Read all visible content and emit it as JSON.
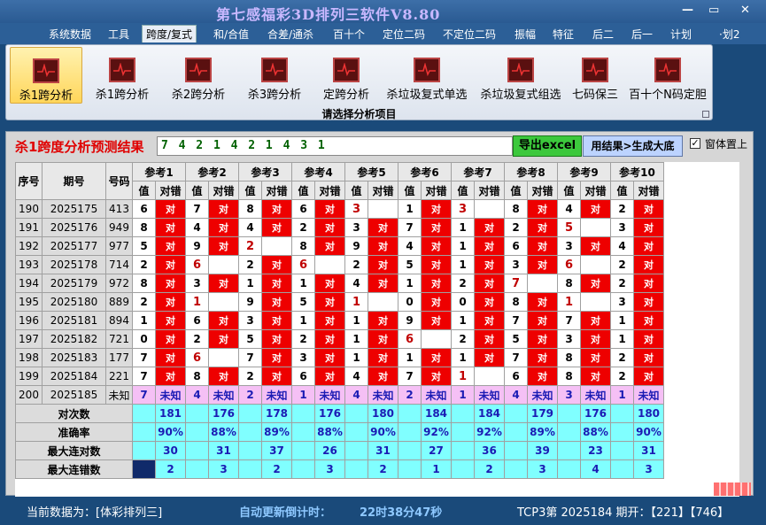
{
  "window": {
    "title": "第七感福彩3D排列三软件V8.80",
    "minimize": "—",
    "restore": "▭",
    "close": "✕"
  },
  "menu": [
    {
      "label": "系统数据"
    },
    {
      "label": "工具"
    },
    {
      "label": "跨度/复式",
      "active": true
    },
    {
      "label": "和/合值"
    },
    {
      "label": "合差/通杀"
    },
    {
      "label": "百十个"
    },
    {
      "label": "定位二码"
    },
    {
      "label": "不定位二码"
    },
    {
      "label": "振幅"
    },
    {
      "label": "特征"
    },
    {
      "label": "后二"
    },
    {
      "label": "后一"
    },
    {
      "label": "计划"
    },
    {
      "label": "·划2"
    }
  ],
  "ribbon": {
    "buttons": [
      "杀1跨分析",
      "杀1跨分析",
      "杀2跨分析",
      "杀3跨分析",
      "定跨分析",
      "杀垃圾复式单选",
      "杀垃圾复式组选",
      "七码保三",
      "百十个N码定胆"
    ],
    "active_index": 0,
    "icon": "chart-icon",
    "group_label": "请选择分析项目"
  },
  "analysis": {
    "title": "杀1跨度分析预测结果",
    "result": "7 4 2 1 4 2 1 4 3 1",
    "excel_button": "导出excel",
    "generate_button": "用结果>生成大底",
    "topmost_label": "窗体置上",
    "topmost_checked": "✓"
  },
  "table": {
    "col_seq": "序号",
    "col_period": "期号",
    "col_number": "号码",
    "refs": [
      "参考1",
      "参考2",
      "参考3",
      "参考4",
      "参考5",
      "参考6",
      "参考7",
      "参考8",
      "参考9",
      "参考10"
    ],
    "sub_val": "值",
    "sub_check": "对错",
    "check_mark": "对",
    "rows": [
      {
        "seq": "190",
        "period": "2025175",
        "num": "413",
        "cells": [
          [
            "6",
            "R"
          ],
          [
            "7",
            "R"
          ],
          [
            "8",
            "R"
          ],
          [
            "6",
            "R"
          ],
          [
            "3",
            "X"
          ],
          [
            "1",
            "R"
          ],
          [
            "3",
            "X"
          ],
          [
            "8",
            "R"
          ],
          [
            "4",
            "R"
          ],
          [
            "2",
            "R"
          ]
        ]
      },
      {
        "seq": "191",
        "period": "2025176",
        "num": "949",
        "cells": [
          [
            "8",
            "R"
          ],
          [
            "4",
            "R"
          ],
          [
            "4",
            "R"
          ],
          [
            "2",
            "R"
          ],
          [
            "3",
            "R"
          ],
          [
            "7",
            "R"
          ],
          [
            "1",
            "R"
          ],
          [
            "2",
            "R"
          ],
          [
            "5",
            "X"
          ],
          [
            "3",
            "R"
          ]
        ]
      },
      {
        "seq": "192",
        "period": "2025177",
        "num": "977",
        "cells": [
          [
            "5",
            "R"
          ],
          [
            "9",
            "R"
          ],
          [
            "2",
            "X"
          ],
          [
            "8",
            "R"
          ],
          [
            "9",
            "R"
          ],
          [
            "4",
            "R"
          ],
          [
            "1",
            "R"
          ],
          [
            "6",
            "R"
          ],
          [
            "3",
            "R"
          ],
          [
            "4",
            "R"
          ]
        ]
      },
      {
        "seq": "193",
        "period": "2025178",
        "num": "714",
        "cells": [
          [
            "2",
            "R"
          ],
          [
            "6",
            "X"
          ],
          [
            "2",
            "R"
          ],
          [
            "6",
            "X"
          ],
          [
            "2",
            "R"
          ],
          [
            "5",
            "R"
          ],
          [
            "1",
            "R"
          ],
          [
            "3",
            "R"
          ],
          [
            "6",
            "X"
          ],
          [
            "2",
            "R"
          ]
        ]
      },
      {
        "seq": "194",
        "period": "2025179",
        "num": "972",
        "cells": [
          [
            "8",
            "R"
          ],
          [
            "3",
            "R"
          ],
          [
            "1",
            "R"
          ],
          [
            "1",
            "R"
          ],
          [
            "4",
            "R"
          ],
          [
            "1",
            "R"
          ],
          [
            "2",
            "R"
          ],
          [
            "7",
            "X"
          ],
          [
            "8",
            "R"
          ],
          [
            "2",
            "R"
          ]
        ]
      },
      {
        "seq": "195",
        "period": "2025180",
        "num": "889",
        "cells": [
          [
            "2",
            "R"
          ],
          [
            "1",
            "X"
          ],
          [
            "9",
            "R"
          ],
          [
            "5",
            "R"
          ],
          [
            "1",
            "X"
          ],
          [
            "0",
            "R"
          ],
          [
            "0",
            "R"
          ],
          [
            "8",
            "R"
          ],
          [
            "1",
            "X"
          ],
          [
            "3",
            "R"
          ]
        ]
      },
      {
        "seq": "196",
        "period": "2025181",
        "num": "894",
        "cells": [
          [
            "1",
            "R"
          ],
          [
            "6",
            "R"
          ],
          [
            "3",
            "R"
          ],
          [
            "1",
            "R"
          ],
          [
            "1",
            "R"
          ],
          [
            "9",
            "R"
          ],
          [
            "1",
            "R"
          ],
          [
            "7",
            "R"
          ],
          [
            "7",
            "R"
          ],
          [
            "1",
            "R"
          ]
        ]
      },
      {
        "seq": "197",
        "period": "2025182",
        "num": "721",
        "cells": [
          [
            "0",
            "R"
          ],
          [
            "2",
            "R"
          ],
          [
            "5",
            "R"
          ],
          [
            "2",
            "R"
          ],
          [
            "1",
            "R"
          ],
          [
            "6",
            "X"
          ],
          [
            "2",
            "R"
          ],
          [
            "5",
            "R"
          ],
          [
            "3",
            "R"
          ],
          [
            "1",
            "R"
          ]
        ]
      },
      {
        "seq": "198",
        "period": "2025183",
        "num": "177",
        "cells": [
          [
            "7",
            "R"
          ],
          [
            "6",
            "X"
          ],
          [
            "7",
            "R"
          ],
          [
            "3",
            "R"
          ],
          [
            "1",
            "R"
          ],
          [
            "1",
            "R"
          ],
          [
            "1",
            "R"
          ],
          [
            "7",
            "R"
          ],
          [
            "8",
            "R"
          ],
          [
            "2",
            "R"
          ]
        ]
      },
      {
        "seq": "199",
        "period": "2025184",
        "num": "221",
        "cells": [
          [
            "7",
            "R"
          ],
          [
            "8",
            "R"
          ],
          [
            "2",
            "R"
          ],
          [
            "6",
            "R"
          ],
          [
            "4",
            "R"
          ],
          [
            "7",
            "R"
          ],
          [
            "1",
            "X"
          ],
          [
            "6",
            "R"
          ],
          [
            "8",
            "R"
          ],
          [
            "2",
            "R"
          ]
        ]
      }
    ],
    "last_row": {
      "seq": "200",
      "period": "2025185",
      "num": "未知",
      "vals": [
        "7",
        "4",
        "2",
        "1",
        "4",
        "2",
        "1",
        "4",
        "3",
        "1"
      ],
      "unknown": "未知"
    },
    "stats": [
      {
        "label": "对次数",
        "values": [
          "181",
          "176",
          "178",
          "176",
          "180",
          "184",
          "184",
          "179",
          "176",
          "180"
        ]
      },
      {
        "label": "准确率",
        "values": [
          "90%",
          "88%",
          "89%",
          "88%",
          "90%",
          "92%",
          "92%",
          "89%",
          "88%",
          "90%"
        ]
      },
      {
        "label": "最大连对数",
        "values": [
          "30",
          "31",
          "37",
          "26",
          "31",
          "27",
          "36",
          "39",
          "23",
          "31"
        ]
      },
      {
        "label": "最大连错数",
        "values": [
          "2",
          "3",
          "2",
          "3",
          "2",
          "1",
          "2",
          "3",
          "4",
          "3"
        ]
      }
    ]
  },
  "status": {
    "current_data": "当前数据为：[体彩排列三]",
    "countdown_label": "自动更新倒计时：",
    "countdown": "22时38分47秒",
    "latest": "TCP3第 2025184 期开：【221】【746】"
  },
  "colors": {
    "correct": "#ee0000",
    "unknown_row": "#f5c0f5",
    "stats_row": "#80ffff"
  }
}
